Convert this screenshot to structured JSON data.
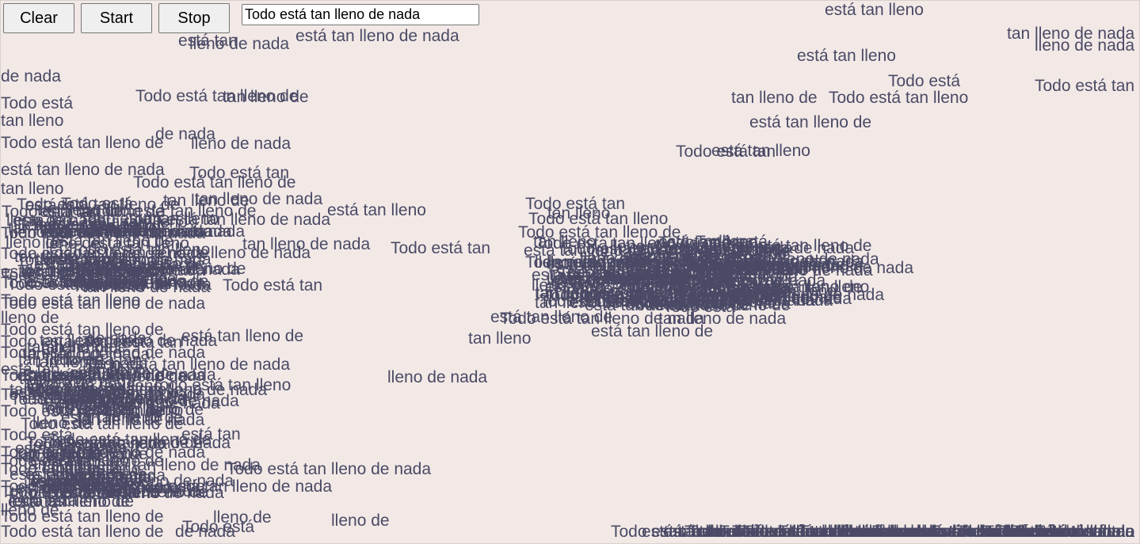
{
  "toolbar": {
    "clear_label": "Clear",
    "start_label": "Start",
    "stop_label": "Stop",
    "phrase_value": "Todo está tan lleno de nada"
  },
  "colors": {
    "background": "#f2e9e6",
    "text": "#4a4a66"
  },
  "fragments": [
    "Todo está tan lleno de nada",
    "Todo está tan lleno de",
    "Todo está tan lleno",
    "Todo está tan",
    "Todo está",
    "está tan lleno de nada",
    "está tan lleno de",
    "está tan lleno",
    "está tan",
    "tan lleno de nada",
    "tan lleno de",
    "tan lleno",
    "lleno de nada",
    "lleno de",
    "de nada"
  ]
}
